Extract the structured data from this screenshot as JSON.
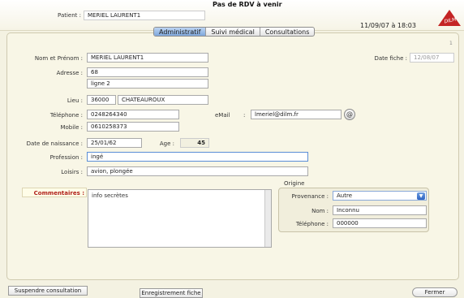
{
  "header": {
    "patient_label": "Patient :",
    "patient_name": "MERIEL LAURENT1",
    "rdv_notice": "Pas de RDV à venir",
    "datetime": "11/09/07 à 18:03",
    "logo_text": "DILM",
    "page_number": "1"
  },
  "tabs": [
    {
      "label": "Administratif",
      "active": true
    },
    {
      "label": "Suivi médical",
      "active": false
    },
    {
      "label": "Consultations",
      "active": false
    }
  ],
  "form": {
    "nom_label": "Nom et Prénom :",
    "nom_value": "MERIEL LAURENT1",
    "date_fiche_label": "Date fiche :",
    "date_fiche_value": "12/08/07",
    "adresse_label": "Adresse :",
    "adresse_line1": "68",
    "adresse_line2": "ligne 2",
    "lieu_label": "Lieu :",
    "lieu_cp": "36000",
    "lieu_ville": "CHATEAUROUX",
    "telephone_label": "Téléphone :",
    "telephone_value": "0248264340",
    "email_label": "eMail",
    "email_sep": ":",
    "email_value": "lmeriel@dilm.fr",
    "email_icon_glyph": "@",
    "mobile_label": "Mobile :",
    "mobile_value": "0610258373",
    "naissance_label": "Date de naissance :",
    "naissance_value": "25/01/62",
    "age_label": "Age :",
    "age_value": "45",
    "profession_label": "Profession :",
    "profession_value": "ingé",
    "loisirs_label": "Loisirs :",
    "loisirs_value": "avion, plongée",
    "commentaires_label": "Commentaires :",
    "commentaires_value": "info secrètes"
  },
  "origine": {
    "title": "Origine",
    "provenance_label": "Provenance :",
    "provenance_value": "Autre",
    "nom_label": "Nom :",
    "nom_value": "Inconnu",
    "telephone_label": "Téléphone :",
    "telephone_value": "000000"
  },
  "footer": {
    "suspend_label": "Suspendre consultation",
    "save_label": "Enregistrement fiche",
    "close_label": "Fermer"
  },
  "colors": {
    "accent_red": "#c42424",
    "tab_active": "#7fa8dc",
    "panel_bg": "#f8f6e6"
  }
}
